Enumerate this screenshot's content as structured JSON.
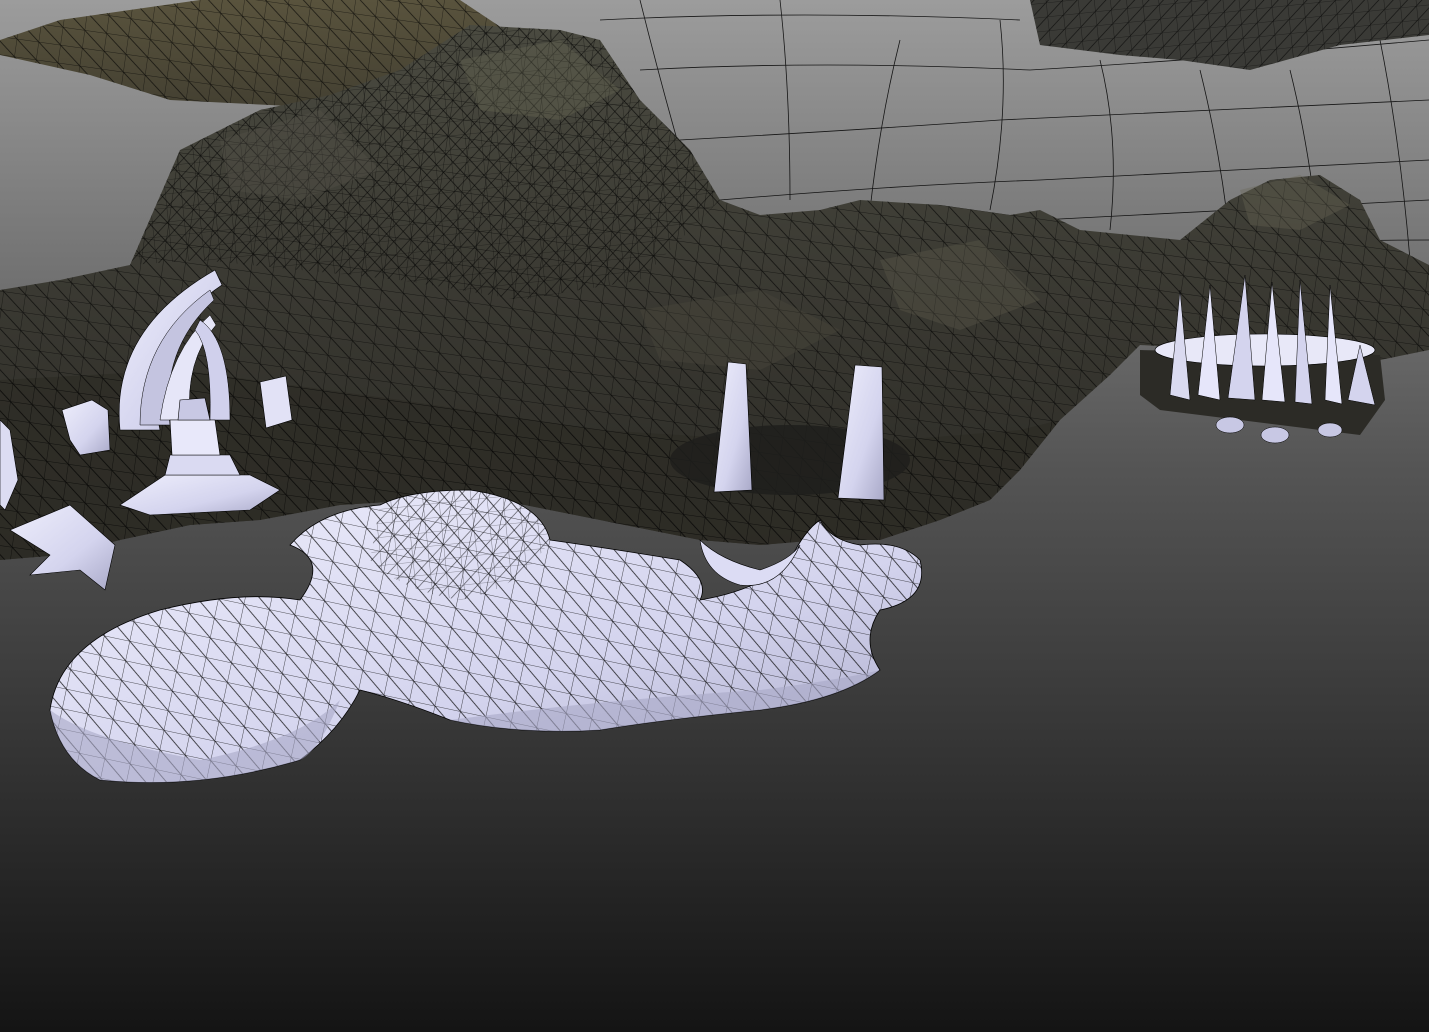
{
  "viewport": {
    "background_top": "#9a9a9a",
    "background_bottom": "#151515",
    "wire_color": "#000000",
    "rock_color": "#3e3c33",
    "rock_dark": "#2a2a26",
    "rock_light": "#5a5848",
    "untextured_color": "#d8d8f0",
    "untextured_shade": "#9a9ab8"
  }
}
